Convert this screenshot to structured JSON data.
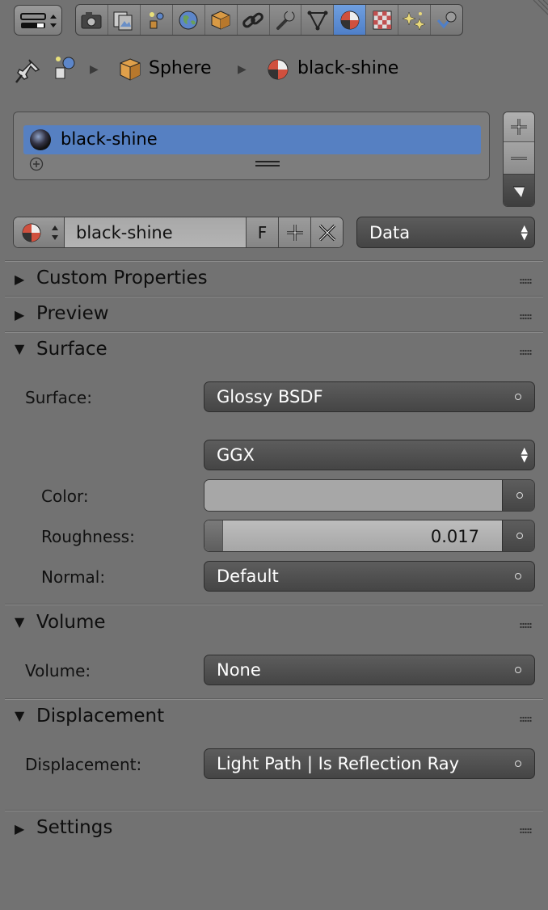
{
  "toolbar": {
    "editor_type_icon": "properties-editor-icon",
    "context_tabs": [
      {
        "name": "render-tab",
        "icon": "camera-icon",
        "active": false
      },
      {
        "name": "render-layers-tab",
        "icon": "render-layers-icon",
        "active": false
      },
      {
        "name": "scene-tab",
        "icon": "scene-icon",
        "active": false
      },
      {
        "name": "world-tab",
        "icon": "world-icon",
        "active": false
      },
      {
        "name": "object-tab",
        "icon": "object-cube-icon",
        "active": false
      },
      {
        "name": "constraints-tab",
        "icon": "constraint-link-icon",
        "active": false
      },
      {
        "name": "modifiers-tab",
        "icon": "wrench-icon",
        "active": false
      },
      {
        "name": "data-tab",
        "icon": "mesh-data-icon",
        "active": false
      },
      {
        "name": "material-tab",
        "icon": "material-icon",
        "active": true
      },
      {
        "name": "texture-tab",
        "icon": "texture-icon",
        "active": false
      },
      {
        "name": "particles-tab",
        "icon": "particles-icon",
        "active": false
      },
      {
        "name": "physics-tab",
        "icon": "physics-icon",
        "active": false
      }
    ]
  },
  "breadcrumb": {
    "object": "Sphere",
    "material": "black-shine"
  },
  "material_slots": {
    "items": [
      {
        "label": "black-shine",
        "selected": true
      }
    ]
  },
  "datablock": {
    "name": "black-shine",
    "fake_user": "F",
    "link": "Data"
  },
  "panels": {
    "custom_properties": "Custom Properties",
    "preview": "Preview",
    "surface": "Surface",
    "volume": "Volume",
    "displacement": "Displacement",
    "settings": "Settings"
  },
  "surface": {
    "surface_label": "Surface:",
    "surface_value": "Glossy BSDF",
    "distribution": "GGX",
    "color_label": "Color:",
    "color_value": "#a7a7a7",
    "roughness_label": "Roughness:",
    "roughness_value": "0.017",
    "roughness_fraction": 0.017,
    "normal_label": "Normal:",
    "normal_value": "Default"
  },
  "volume": {
    "label": "Volume:",
    "value": "None"
  },
  "displacement": {
    "label": "Displacement:",
    "value": "Light Path | Is Reflection Ray"
  },
  "colors": {
    "accent": "#5680c2",
    "background": "#727272"
  }
}
